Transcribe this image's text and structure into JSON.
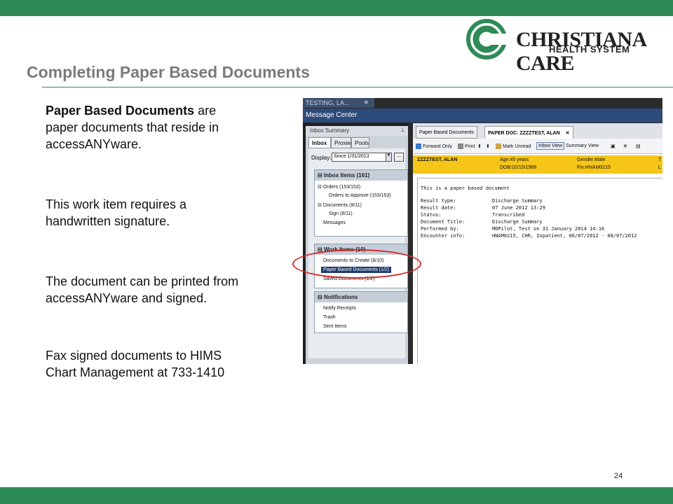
{
  "slide": {
    "title": "Completing Paper Based Documents",
    "page_number": "24",
    "logo": {
      "line1": "CHRISTIANA CARE",
      "line2": "HEALTH SYSTEM"
    },
    "paragraphs": [
      {
        "bold": "Paper Based Documents",
        "rest1": " are",
        "line2": "paper documents that reside in",
        "line3": "accessANYware."
      },
      {
        "line1": "This work item requires a",
        "line2": "handwritten signature."
      },
      {
        "line1": "The document can be printed from",
        "line2": "accessANYware and signed."
      },
      {
        "line1": "Fax signed documents to HIMS",
        "line2": "Chart Management at 733-1410"
      }
    ],
    "colors": {
      "brand_green": "#2e8b57",
      "title_gray": "#7a7a7a",
      "highlight_red": "#d42a2a",
      "patient_bar": "#f5c518"
    }
  },
  "screenshot": {
    "window_tab": "TESTING, LA...",
    "header": "Message Center",
    "inbox_summary": "Inbox Summary",
    "left_tabs": [
      "Inbox",
      "Proxies",
      "Pools"
    ],
    "display_label": "Display:",
    "display_value": "Since 1/31/2013",
    "display_more": "...",
    "inbox_items": {
      "header": "Inbox Items (161)",
      "items": [
        "Orders (153/153)",
        "Orders to Approve (153/153)",
        "Documents (8/11)",
        "Sign (8/11)",
        "Messages"
      ]
    },
    "work_items": {
      "header": "Work Items (10)",
      "items": [
        "Documents to Create (8/10)",
        "Paper Based Documents (1/2)",
        "Saved Documents (1/2)"
      ]
    },
    "notifications": {
      "header": "Notifications",
      "items": [
        "Notify Receipts",
        "Trash",
        "Sent Items"
      ]
    },
    "right_tabs": [
      "Paper Based Documents",
      "PAPER DOC: ZZZZTEST, ALAN"
    ],
    "toolbar": [
      "Forward Only",
      "Print",
      "Mark Unread",
      "Inbox View",
      "Summary View"
    ],
    "patient": {
      "name": "ZZZZTEST, ALAN",
      "age": "Age:45 years",
      "dob": "DOB:02/15/1968",
      "gender": "Gender:Male",
      "fin": "Fin:HNAM0215",
      "trail1": "T",
      "trail2": "L"
    },
    "document": {
      "intro": "This is a paper based document",
      "fields": [
        {
          "label": "Result type:",
          "value": "Discharge Summary"
        },
        {
          "label": "Result date:",
          "value": "07 June 2012 13:29"
        },
        {
          "label": "Status:",
          "value": "Transcribed"
        },
        {
          "label": "Document Title:",
          "value": "Discharge Summary"
        },
        {
          "label": "Performed by:",
          "value": "MDPilot, Test on 31 January 2014 14:16"
        },
        {
          "label": "Encounter info:",
          "value": "HNAM0215, CHR, Inpatient, 06/07/2012 - 08/07/2012"
        }
      ]
    }
  }
}
